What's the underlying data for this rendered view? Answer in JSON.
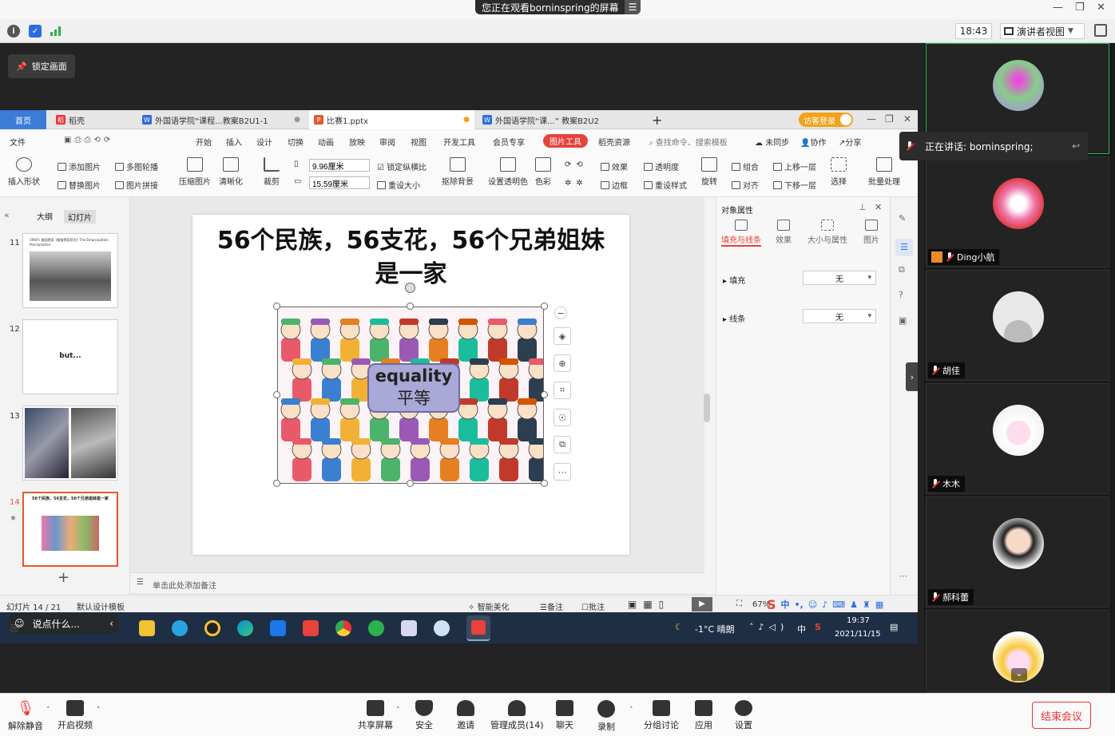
{
  "zoom": {
    "banner": "您正在观看borninspring的屏幕",
    "time": "18:43",
    "view_label": "演讲者视图",
    "lock_label": "锁定画面",
    "speaking": "正在讲话: borninspring;",
    "bottom": {
      "mute": "解除静音",
      "video": "开启视频",
      "share": "共享屏幕",
      "security": "安全",
      "invite": "邀请",
      "participants": "管理成员(14)",
      "chat": "聊天",
      "record": "录制",
      "breakout": "分组讨论",
      "apps": "应用",
      "settings": "设置",
      "end": "结束会议"
    },
    "participants": [
      {
        "name": "",
        "avatar": "photo-kid"
      },
      {
        "name": "Ding小航",
        "avatar": "photo-red"
      },
      {
        "name": "胡佳",
        "avatar": "default-avatar-icon"
      },
      {
        "name": "木木",
        "avatar": "cartoon-girl"
      },
      {
        "name": "郝科蕾",
        "avatar": "photo-woman"
      },
      {
        "name": "",
        "avatar": "cartoon-yellow-hat"
      }
    ]
  },
  "wps": {
    "tabs": {
      "home": "首页",
      "daoke": "稻壳",
      "doc1": "外国语学院“课程...教案B2U1-1",
      "ppt": "比赛1.pptx",
      "doc2": "外国语学院“课...” 教案B2U2",
      "plus": "+"
    },
    "login": "访客登录",
    "menu": {
      "file": "文件",
      "start": "开始",
      "insert": "插入",
      "design": "设计",
      "switch": "切换",
      "anim": "动画",
      "show": "放映",
      "review": "审阅",
      "view": "视图",
      "dev": "开发工具",
      "member": "会员专享",
      "pictool": "图片工具",
      "dkres": "稻壳资源",
      "search": "查找命令、搜索模板",
      "unsync": "未同步",
      "collab": "协作",
      "share": "分享"
    },
    "ribbon": {
      "shape": "插入形状",
      "addpic": "添加图片",
      "multi": "多图轮播",
      "replace": "替换图片",
      "splice": "图片拼接",
      "compress": "压缩图片",
      "clear": "清晰化",
      "crop": "裁剪",
      "width": "9.96厘米",
      "height": "15.59厘米",
      "lock": "锁定纵横比",
      "resize": "重设大小",
      "removebg": "抠除背景",
      "transparent": "设置透明色",
      "color": "色彩",
      "effect": "效果",
      "opacity": "透明度",
      "border": "边框",
      "restyle": "重设样式",
      "rotate": "旋转",
      "group": "组合",
      "align": "对齐",
      "up": "上移一层",
      "down": "下移一层",
      "select": "选择",
      "batch": "批量处理"
    },
    "panel": {
      "outline": "大纲",
      "slides": "幻灯片"
    },
    "thumbs": [
      {
        "num": "11",
        "text": "1960's 美国黑奴《解放黑奴宣言》The Emancipation Proclamation"
      },
      {
        "num": "12",
        "text": "but..."
      },
      {
        "num": "13",
        "text": ""
      },
      {
        "num": "14",
        "text": "56个民族，56支花，56个兄弟姐妹是一家"
      }
    ],
    "slide": {
      "title": "56个民族，56支花，56个兄弟姐妹是一家",
      "eq_en": "equality",
      "eq_cn": "平等"
    },
    "notes": "单击此处添加备注",
    "props": {
      "title": "对象属性",
      "tab_fill": "填充与线条",
      "tab_effect": "效果",
      "tab_size": "大小与属性",
      "tab_pic": "图片",
      "fill": "填充",
      "line": "线条",
      "fill_val": "无",
      "line_val": "无"
    },
    "status": {
      "pages": "幻灯片 14 / 21",
      "template": "默认设计模板",
      "beauty": "智能美化",
      "notes": "备注",
      "comment": "批注",
      "zoom": "67%"
    },
    "taskbar": {
      "weather": "-1°C 晴朗",
      "lang": "中",
      "clock": "19:37",
      "date": "2021/11/15",
      "search": "说点什么..."
    }
  }
}
